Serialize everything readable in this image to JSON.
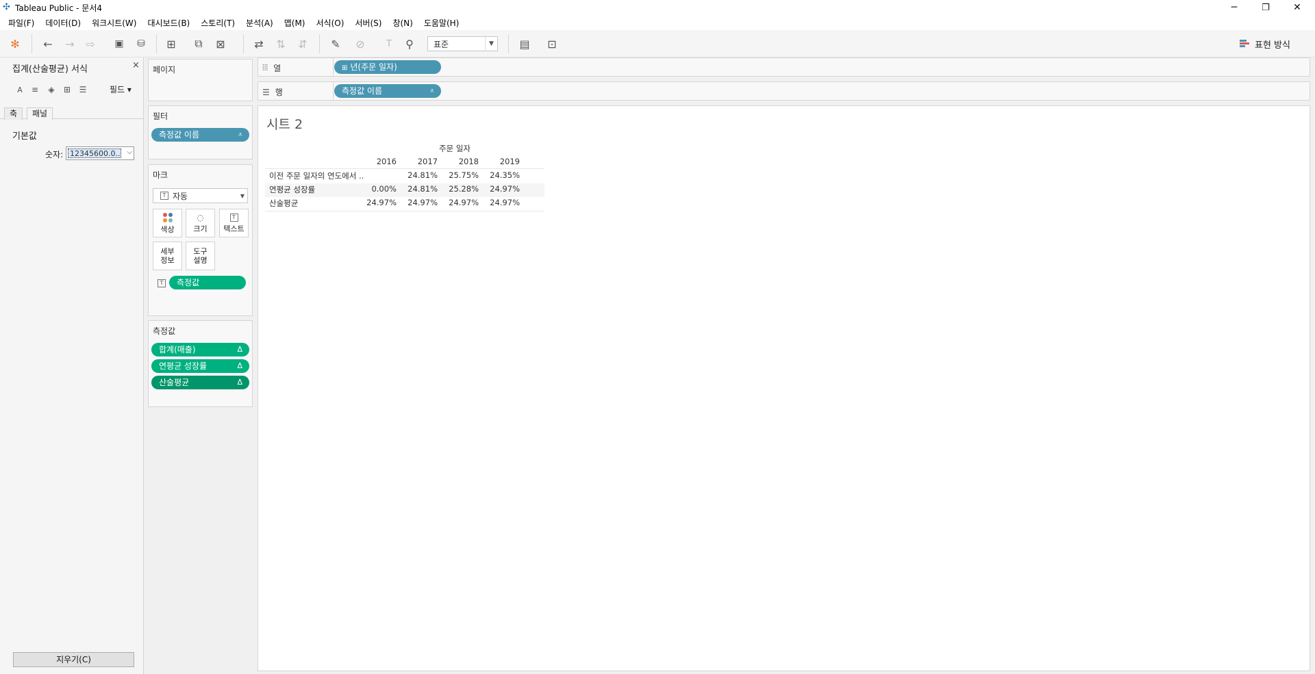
{
  "window": {
    "title": "Tableau Public - 문서4",
    "minimize_glyph": "─",
    "maximize_glyph": "❐",
    "close_glyph": "✕"
  },
  "menu": [
    "파일(F)",
    "데이터(D)",
    "워크시트(W)",
    "대시보드(B)",
    "스토리(T)",
    "분석(A)",
    "맵(M)",
    "서식(O)",
    "서버(S)",
    "창(N)",
    "도움말(H)"
  ],
  "toolbar": {
    "fit_select": "표준",
    "show_me": "표현 방식",
    "icons": [
      "tableau-logo-icon",
      "undo-icon",
      "redo-icon",
      "replay-icon",
      "save-icon",
      "new-datasource-icon",
      "new-worksheet-icon",
      "duplicate-icon",
      "clear-sheet-icon",
      "swap-icon",
      "sort-asc-icon",
      "sort-desc-icon",
      "highlight-icon",
      "group-icon",
      "label-icon",
      "pin-icon",
      "card-toggle-icon",
      "presentation-icon"
    ]
  },
  "format_pane": {
    "title": "집계(산술평균) 서식",
    "close": "×",
    "icons": [
      "font-icon",
      "align-icon",
      "shading-icon",
      "borders-icon",
      "lines-icon"
    ],
    "font_glyph": "A",
    "fields_label": "필드 ▾",
    "tabs": [
      "축",
      "패널"
    ],
    "section": "기본값",
    "number_label": "숫자:",
    "number_value": "12345600.0...",
    "clear_button": "지우기(C)"
  },
  "cards": {
    "pages_title": "페이지",
    "filters_title": "필터",
    "filter_pill": "측정값 이름",
    "marks_title": "마크",
    "mark_type": "자동",
    "mark_buttons": {
      "color": "색상",
      "size": "크기",
      "text": "텍스트",
      "detail": "세부\n정보",
      "tooltip": "도구\n설명"
    },
    "marks_text_pill": "측정값",
    "measures_title": "측정값",
    "measure_pills": [
      "합계(매출)",
      "연평균 성장률",
      "산술평균"
    ]
  },
  "shelves": {
    "columns_label": "열",
    "columns_pill": "년(주문 일자)",
    "rows_label": "행",
    "rows_pill": "측정값 이름"
  },
  "view": {
    "sheet_title": "시트 2",
    "column_header": "주문 일자",
    "years": [
      "2016",
      "2017",
      "2018",
      "2019"
    ],
    "rows": [
      {
        "label": "이전 주문 일자의 연도에서 ..",
        "values": [
          "",
          "24.81%",
          "25.75%",
          "24.35%"
        ]
      },
      {
        "label": "연평균 성장률",
        "values": [
          "0.00%",
          "24.81%",
          "25.28%",
          "24.97%"
        ]
      },
      {
        "label": "산술평균",
        "values": [
          "24.97%",
          "24.97%",
          "24.97%",
          "24.97%"
        ]
      }
    ]
  },
  "colors": {
    "dimension_pill": "#4996b2",
    "measure_pill": "#00b180",
    "active_measure_pill": "#00956a"
  }
}
